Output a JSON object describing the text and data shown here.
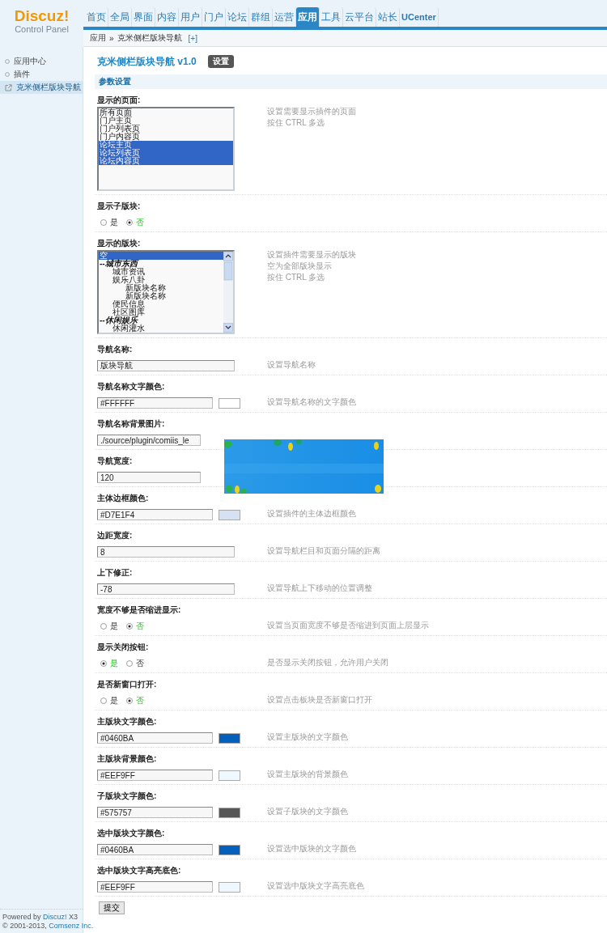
{
  "header": {
    "logo": {
      "title": "Discuz!",
      "subtitle": "Control Panel"
    },
    "nav": [
      {
        "label": "首页",
        "selected": false
      },
      {
        "label": "全局",
        "selected": false
      },
      {
        "label": "界面",
        "selected": false
      },
      {
        "label": "内容",
        "selected": false
      },
      {
        "label": "用户",
        "selected": false
      },
      {
        "label": "门户",
        "selected": false
      },
      {
        "label": "论坛",
        "selected": false
      },
      {
        "label": "群组",
        "selected": false
      },
      {
        "label": "运营",
        "selected": false
      },
      {
        "label": "应用",
        "selected": true
      },
      {
        "label": "工具",
        "selected": false
      },
      {
        "label": "云平台",
        "selected": false
      },
      {
        "label": "站长",
        "selected": false
      },
      {
        "label": "UCenter",
        "selected": false
      }
    ]
  },
  "breadcrumb": {
    "items": [
      "应用",
      "克米侧栏版块导航"
    ],
    "separator": "»",
    "add": "[+]"
  },
  "sidebar": {
    "items": [
      {
        "label": "应用中心",
        "kind": "dot",
        "selected": false
      },
      {
        "label": "插件",
        "kind": "dot",
        "selected": false
      },
      {
        "label": "克米侧栏版块导航",
        "kind": "link",
        "selected": true
      }
    ],
    "footer": {
      "powered_prefix": "Powered by ",
      "powered_link": "Discuz!",
      "powered_suffix": " X3",
      "copyright_prefix": "© 2001-2013, ",
      "copyright_link": "Comsenz Inc."
    }
  },
  "content": {
    "title": "克米侧栏版块导航 v1.0",
    "badge": "设置",
    "section": "参数设置",
    "settings": [
      {
        "kind": "multiselect",
        "label": "显示的页面:",
        "scrollbar": false,
        "hints": [
          "设置需要显示插件的页面",
          "按住 CTRL 多选"
        ],
        "options": [
          {
            "label": "所有页面",
            "kind": "item",
            "selected": false
          },
          {
            "label": "门户主页",
            "kind": "item",
            "selected": false
          },
          {
            "label": "门户列表页",
            "kind": "item",
            "selected": false
          },
          {
            "label": "门户内容页",
            "kind": "item",
            "selected": false
          },
          {
            "label": "论坛主页",
            "kind": "item",
            "selected": true
          },
          {
            "label": "论坛列表页",
            "kind": "item",
            "selected": true
          },
          {
            "label": "论坛内容页",
            "kind": "item",
            "selected": true
          }
        ]
      },
      {
        "kind": "radio",
        "label": "显示子版块:",
        "options": [
          {
            "label": "是",
            "selected": false
          },
          {
            "label": "否",
            "selected": true
          }
        ]
      },
      {
        "kind": "multiselect",
        "label": "显示的版块:",
        "scrollbar": true,
        "hints": [
          "设置插件需要显示的版块",
          "空为全部版块显示",
          "按住 CTRL 多选"
        ],
        "options": [
          {
            "label": "空",
            "kind": "item",
            "selected": true
          },
          {
            "label": "--城市东西",
            "kind": "group",
            "selected": false,
            "children": [
              {
                "label": "城市资讯",
                "kind": "item",
                "selected": false
              },
              {
                "label": "娱乐八卦",
                "kind": "item",
                "selected": false,
                "children": [
                  {
                    "label": "新版块名称",
                    "kind": "item",
                    "selected": false
                  },
                  {
                    "label": "新版块名称",
                    "kind": "item",
                    "selected": false
                  }
                ]
              },
              {
                "label": "便民信息",
                "kind": "item",
                "selected": false
              },
              {
                "label": "社区图库",
                "kind": "item",
                "selected": false
              }
            ]
          },
          {
            "label": "--休闲娱乐",
            "kind": "group",
            "selected": false,
            "children": [
              {
                "label": "休闲灌水",
                "kind": "item",
                "selected": false
              }
            ]
          }
        ]
      },
      {
        "kind": "text",
        "label": "导航名称:",
        "value": "版块导航",
        "hints": [
          "设置导航名称"
        ]
      },
      {
        "kind": "color",
        "label": "导航名称文字颜色:",
        "value": "#FFFFFF",
        "hints": [
          "设置导航名称的文字颜色"
        ]
      },
      {
        "kind": "text",
        "label": "导航名称背景图片:",
        "value": "./source/plugin/comiis_le",
        "cut": true
      },
      {
        "kind": "text",
        "label": "导航宽度:",
        "value": "120",
        "cut": true
      },
      {
        "kind": "color",
        "label": "主体边框颜色:",
        "value": "#D7E1F4",
        "hints": [
          "设置插件的主体边框颜色"
        ]
      },
      {
        "kind": "text",
        "label": "边距宽度:",
        "value": "8",
        "hints": [
          "设置导航栏目和页面分隔的距离"
        ]
      },
      {
        "kind": "text",
        "label": "上下修正:",
        "value": "-78",
        "hints": [
          "设置导航上下移动的位置调整"
        ]
      },
      {
        "kind": "radio",
        "label": "宽度不够是否缩进显示:",
        "hints": [
          "设置当页面宽度不够是否缩进到页面上层显示"
        ],
        "options": [
          {
            "label": "是",
            "selected": false
          },
          {
            "label": "否",
            "selected": true
          }
        ]
      },
      {
        "kind": "radio",
        "label": "显示关闭按钮:",
        "hints": [
          "是否显示关闭按钮，允许用户关闭"
        ],
        "options": [
          {
            "label": "是",
            "selected": true
          },
          {
            "label": "否",
            "selected": false
          }
        ]
      },
      {
        "kind": "radio",
        "label": "是否新窗口打开:",
        "hints": [
          "设置点击板块是否新窗口打开"
        ],
        "options": [
          {
            "label": "是",
            "selected": false
          },
          {
            "label": "否",
            "selected": true
          }
        ]
      },
      {
        "kind": "color",
        "label": "主版块文字颜色:",
        "value": "#0460BA",
        "hints": [
          "设置主版块的文字颜色"
        ]
      },
      {
        "kind": "color",
        "label": "主版块背景颜色:",
        "value": "#EEF9FF",
        "hints": [
          "设置主版块的背景颜色"
        ]
      },
      {
        "kind": "color",
        "label": "子版块文字颜色:",
        "value": "#575757",
        "hints": [
          "设置子版块的文字颜色"
        ]
      },
      {
        "kind": "color",
        "label": "选中版块文字颜色:",
        "value": "#0460BA",
        "hints": [
          "设置选中版块的文字颜色"
        ]
      },
      {
        "kind": "color",
        "label": "选中版块文字高亮底色:",
        "value": "#EEF9FF",
        "hints": [
          "设置选中版块文字高亮底色"
        ]
      }
    ],
    "submit": "提交"
  }
}
